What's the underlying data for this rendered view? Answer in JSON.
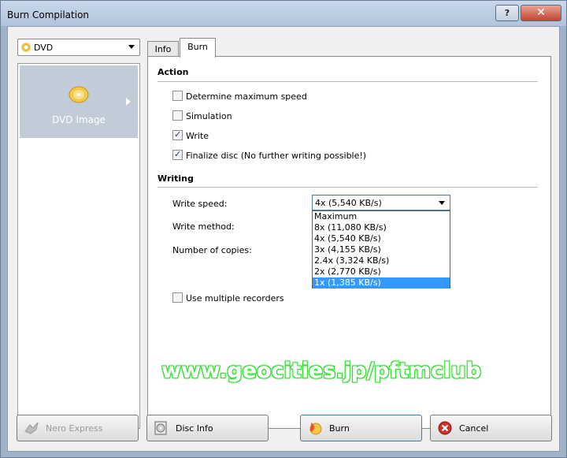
{
  "window": {
    "title": "Burn Compilation",
    "help_label": "?",
    "close_label": "✕"
  },
  "left": {
    "combo_value": "DVD",
    "panel_item_label": "DVD Image"
  },
  "tabs": [
    {
      "label": "Info"
    },
    {
      "label": "Burn"
    }
  ],
  "action": {
    "heading": "Action",
    "options": [
      {
        "label": "Determine maximum speed",
        "checked": false
      },
      {
        "label": "Simulation",
        "checked": false
      },
      {
        "label": "Write",
        "checked": true
      },
      {
        "label": "Finalize disc (No further writing possible!)",
        "checked": true
      }
    ]
  },
  "writing": {
    "heading": "Writing",
    "write_speed_label": "Write speed:",
    "write_speed_value": "4x (5,540 KB/s)",
    "write_method_label": "Write method:",
    "copies_label": "Number of copies:",
    "multiple_recorders_label": "Use multiple recorders",
    "multiple_recorders_checked": false,
    "speed_options": [
      "Maximum",
      "8x (11,080 KB/s)",
      "4x (5,540 KB/s)",
      "3x (4,155 KB/s)",
      "2.4x (3,324 KB/s)",
      "2x (2,770 KB/s)",
      "1x (1,385 KB/s)"
    ],
    "speed_selected_index": 6
  },
  "watermark": "www.geocities.jp/pftmclub",
  "buttons": {
    "nero_express": "Nero Express",
    "disc_info": "Disc Info",
    "burn": "Burn",
    "cancel": "Cancel"
  },
  "colors": {
    "selection": "#3399ff",
    "titlebar": "#b1c4da",
    "close": "#c4432e",
    "watermark_glow": "#31e831"
  }
}
